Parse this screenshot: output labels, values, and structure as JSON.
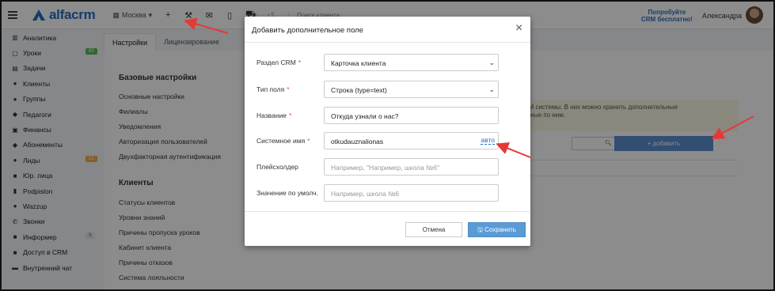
{
  "topbar": {
    "logo_text": "alfacrm",
    "branch": "Москва",
    "search_placeholder": "Поиск клиента",
    "promo_line1": "Попробуйте",
    "promo_line2": "CRM бесплатно!",
    "user_name": "Александра",
    "icons": [
      "plus-icon",
      "wrench-icon",
      "envelope-icon",
      "phone-icon",
      "cart-icon",
      "history-icon"
    ]
  },
  "sidebar": {
    "items": [
      {
        "label": "Аналитика",
        "icon": "analytics-icon",
        "glyph": "▥"
      },
      {
        "label": "Уроки",
        "icon": "calendar-icon",
        "glyph": "▢",
        "badge": "60",
        "badge_color": "#5cb85c"
      },
      {
        "label": "Задачи",
        "icon": "tasks-icon",
        "glyph": "▤"
      },
      {
        "label": "Клиенты",
        "icon": "user-icon",
        "glyph": "●"
      },
      {
        "label": "Группы",
        "icon": "users-icon",
        "glyph": "●"
      },
      {
        "label": "Педагоги",
        "icon": "graduation-icon",
        "glyph": "◆"
      },
      {
        "label": "Финансы",
        "icon": "money-icon",
        "glyph": "▣"
      },
      {
        "label": "Абонементы",
        "icon": "tag-icon",
        "glyph": "◆"
      },
      {
        "label": "Лиды",
        "icon": "user-plus-icon",
        "glyph": "●",
        "badge": "21",
        "badge_color": "#f0ad4e"
      },
      {
        "label": "Юр. лица",
        "icon": "briefcase-icon",
        "glyph": "■"
      },
      {
        "label": "Podpislon",
        "icon": "file-icon",
        "glyph": "▮"
      },
      {
        "label": "Wazzup",
        "icon": "whatsapp-icon",
        "glyph": "●"
      },
      {
        "label": "Звонки",
        "icon": "phone-icon",
        "glyph": "✆"
      },
      {
        "label": "Информер",
        "icon": "informer-icon",
        "glyph": "■",
        "badge": "3",
        "badge_color": "#e6e6e6"
      },
      {
        "label": "Доступ в CRM",
        "icon": "lock-icon",
        "glyph": "■"
      },
      {
        "label": "Внутренний чат",
        "icon": "chat-icon",
        "glyph": "▬"
      }
    ]
  },
  "tabs": {
    "settings": "Настройки",
    "license": "Лицензирование"
  },
  "settings": {
    "basic_title": "Базовые настройки",
    "basic_links": [
      "Основные настройки",
      "Филиалы",
      "Уведомления",
      "Авторизация пользователей",
      "Двухфакторная аутентификация"
    ],
    "clients_title": "Клиенты",
    "clients_links": [
      "Статусы клиентов",
      "Уровни знаний",
      "Причины пропуска уроков",
      "Кабинет клиента",
      "Причины отказов",
      "Система лояльности"
    ]
  },
  "background": {
    "info_line1": "CRM системы. В них можно хранить дополнительные",
    "info_line2": "данные по ним.",
    "add_label": "+ добавить"
  },
  "modal": {
    "title": "Добавить дополнительное поле",
    "close": "×",
    "fields": {
      "section": {
        "label": "Раздел CRM",
        "value": "Карточка клиента"
      },
      "type": {
        "label": "Тип поля",
        "value": "Строка (type=text)"
      },
      "name": {
        "label": "Название",
        "value": "Откуда узнали о нас?"
      },
      "sysname": {
        "label": "Системное имя",
        "value": "otkudauznalionas",
        "auto": "авто"
      },
      "placeholder": {
        "label": "Плейсхолдер",
        "placeholder": "Например, \"Например, школа №6\""
      },
      "default": {
        "label": "Значение по умолч.",
        "placeholder": "Например, школа №6"
      }
    },
    "required_mark": "*",
    "cancel": "Отмена",
    "save": "Сохранить"
  },
  "colors": {
    "brand": "#1f6fc4",
    "annotation_arrow": "#e53935",
    "save_button": "#5b9bd5"
  }
}
